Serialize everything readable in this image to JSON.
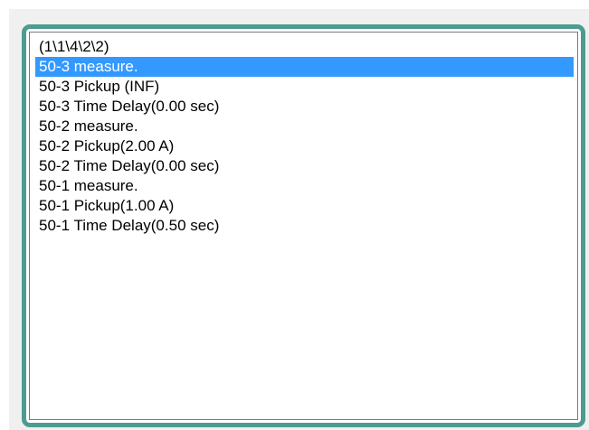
{
  "listbox": {
    "selected_index": 1,
    "items": [
      {
        "label": "(1\\1\\4\\2\\2)"
      },
      {
        "label": "50-3 measure."
      },
      {
        "label": "50-3 Pickup (INF)"
      },
      {
        "label": "50-3 Time Delay(0.00 sec)"
      },
      {
        "label": "50-2 measure."
      },
      {
        "label": "50-2 Pickup(2.00 A)"
      },
      {
        "label": "50-2 Time Delay(0.00 sec)"
      },
      {
        "label": "50-1 measure."
      },
      {
        "label": "50-1 Pickup(1.00 A)"
      },
      {
        "label": "50-1 Time Delay(0.50 sec)"
      }
    ]
  },
  "colors": {
    "frame_border": "#4e9b8f",
    "selection_background": "#3399ff",
    "selection_text": "#ffffff",
    "window_background": "#f0f0f0"
  }
}
